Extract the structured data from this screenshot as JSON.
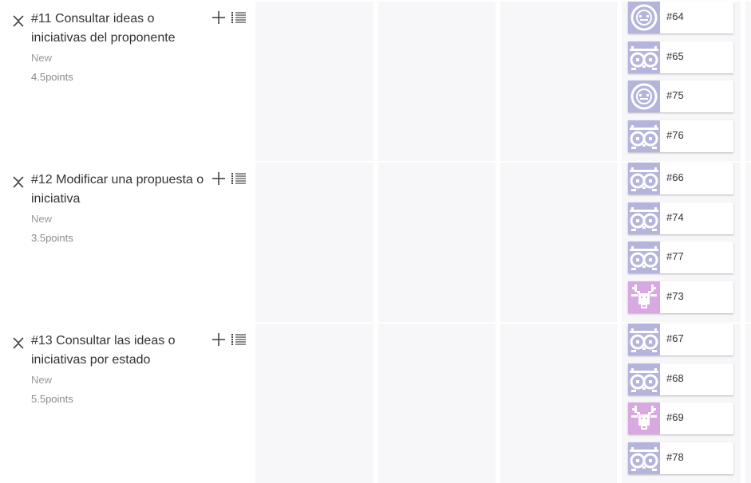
{
  "stories": [
    {
      "title": "#11 Consultar ideas o iniciativas del proponente",
      "status": "New",
      "points": "4.5points",
      "tasks": [
        {
          "ref": "#64",
          "avatar": "face-avatar-icon",
          "color": "#b4b4dc"
        },
        {
          "ref": "#65",
          "avatar": "owl-avatar-icon",
          "color": "#b4b4dc"
        },
        {
          "ref": "#75",
          "avatar": "face-avatar-icon",
          "color": "#b4b4dc"
        },
        {
          "ref": "#76",
          "avatar": "owl-avatar-icon",
          "color": "#b4b4dc"
        }
      ]
    },
    {
      "title": "#12 Modificar una propuesta o iniciativa",
      "status": "New",
      "points": "3.5points",
      "tasks": [
        {
          "ref": "#66",
          "avatar": "owl-avatar-icon",
          "color": "#b4b4dc"
        },
        {
          "ref": "#74",
          "avatar": "owl-avatar-icon",
          "color": "#b4b4dc"
        },
        {
          "ref": "#77",
          "avatar": "owl-avatar-icon",
          "color": "#b4b4dc"
        },
        {
          "ref": "#73",
          "avatar": "deer-avatar-icon",
          "color": "#d8a8e0"
        }
      ]
    },
    {
      "title": "#13 Consultar las ideas o iniciativas por estado",
      "status": "New",
      "points": "5.5points",
      "tasks": [
        {
          "ref": "#67",
          "avatar": "owl-avatar-icon",
          "color": "#b4b4dc"
        },
        {
          "ref": "#68",
          "avatar": "owl-avatar-icon",
          "color": "#b4b4dc"
        },
        {
          "ref": "#69",
          "avatar": "deer-avatar-icon",
          "color": "#d8a8e0"
        },
        {
          "ref": "#78",
          "avatar": "owl-avatar-icon",
          "color": "#b4b4dc"
        }
      ]
    }
  ],
  "colors": {
    "column_bg": "#f7f7f9",
    "owl_avatar": "#b4b4dc",
    "deer_avatar": "#d8a8e0"
  }
}
